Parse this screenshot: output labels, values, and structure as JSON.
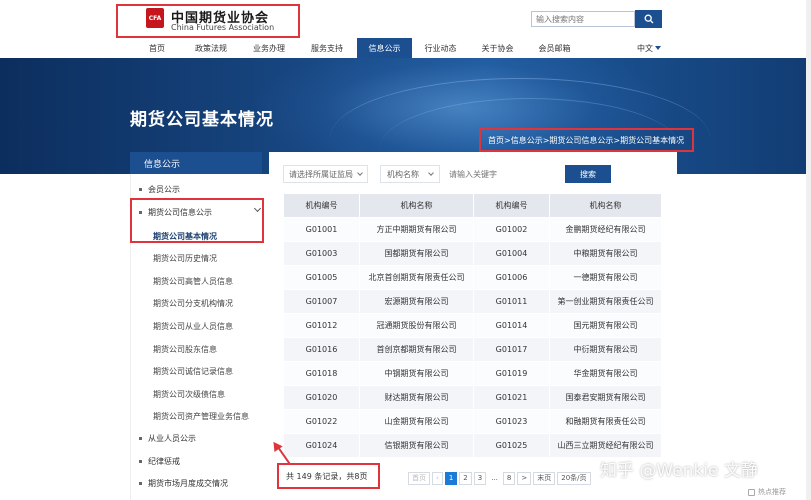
{
  "header": {
    "logo_cn": "中国期货业协会",
    "logo_en": "China Futures Association",
    "logo_mark": "CFA",
    "search_placeholder": "输入搜索内容"
  },
  "nav": {
    "items": [
      "首页",
      "政策法规",
      "业务办理",
      "服务支持",
      "信息公示",
      "行业动态",
      "关于协会",
      "会员邮箱"
    ],
    "active_index": 4,
    "language": "中文"
  },
  "banner": {
    "title": "期货公司基本情况",
    "breadcrumb": "首页>信息公示>期货公司信息公示>期货公司基本情况"
  },
  "sidebar": {
    "header": "信息公示",
    "items": [
      {
        "label": "会员公示"
      },
      {
        "label": "期货公司信息公示"
      },
      {
        "label": "期货公司基本情况"
      },
      {
        "label": "期货公司历史情况"
      },
      {
        "label": "期货公司高管人员信息"
      },
      {
        "label": "期货公司分支机构情况"
      },
      {
        "label": "期货公司从业人员信息"
      },
      {
        "label": "期货公司股东信息"
      },
      {
        "label": "期货公司诚信记录信息"
      },
      {
        "label": "期货公司次级债信息"
      },
      {
        "label": "期货公司资产管理业务信息"
      },
      {
        "label": "从业人员公示"
      },
      {
        "label": "纪律惩戒"
      },
      {
        "label": "期货市场月度成交情况"
      }
    ]
  },
  "filters": {
    "regulator_placeholder": "请选择所属证监局",
    "field_select": "机构名称",
    "keyword_placeholder": "请输入关键字",
    "search_label": "搜索"
  },
  "table": {
    "headers": [
      "机构编号",
      "机构名称",
      "机构编号",
      "机构名称"
    ],
    "rows": [
      [
        "G01001",
        "方正中期期货有限公司",
        "G01002",
        "金鹏期货经纪有限公司"
      ],
      [
        "G01003",
        "国都期货有限公司",
        "G01004",
        "中粮期货有限公司"
      ],
      [
        "G01005",
        "北京首创期货有限责任公司",
        "G01006",
        "一德期货有限公司"
      ],
      [
        "G01007",
        "宏源期货有限公司",
        "G01011",
        "第一创业期货有限责任公司"
      ],
      [
        "G01012",
        "冠通期货股份有限公司",
        "G01014",
        "国元期货有限公司"
      ],
      [
        "G01016",
        "首创京都期货有限公司",
        "G01017",
        "中衍期货有限公司"
      ],
      [
        "G01018",
        "中钢期货有限公司",
        "G01019",
        "华金期货有限公司"
      ],
      [
        "G01020",
        "财达期货有限公司",
        "G01021",
        "国泰君安期货有限公司"
      ],
      [
        "G01022",
        "山金期货有限公司",
        "G01023",
        "和融期货有限责任公司"
      ],
      [
        "G01024",
        "信银期货有限公司",
        "G01025",
        "山西三立期货经纪有限公司"
      ]
    ]
  },
  "pagination": {
    "summary": "共 149 条记录，共8页",
    "prev": "首页",
    "pages": [
      "1",
      "2",
      "3",
      "...",
      "8"
    ],
    "current": "1",
    "next": ">",
    "last": "末页",
    "page_size": "20条/页"
  },
  "overlay": {
    "watermark": "知乎 @Wenkie 文静",
    "recommend": "热点推荐"
  },
  "colors": {
    "brand_blue": "#1c4f8f",
    "annotation_red": "#e0343c",
    "logo_red": "#c4161c"
  }
}
